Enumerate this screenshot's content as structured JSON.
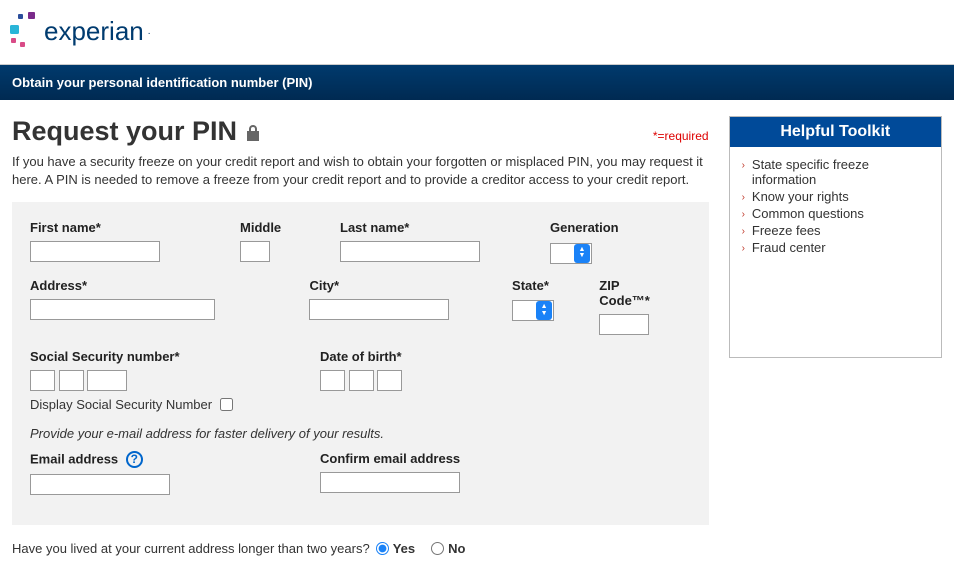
{
  "logo": {
    "text": "experian"
  },
  "banner": "Obtain your personal identification number (PIN)",
  "title": "Request your PIN",
  "required_legend": "*=required",
  "intro": "If you have a security freeze on your credit report and wish to obtain your forgotten or misplaced PIN, you may request it here. A PIN is needed to remove a freeze from your credit report and to provide a creditor access to your credit report.",
  "labels": {
    "first_name": "First name*",
    "middle": "Middle",
    "last_name": "Last name*",
    "generation": "Generation",
    "address": "Address*",
    "city": "City*",
    "state": "State*",
    "zip": "ZIP Code™*",
    "ssn": "Social Security number*",
    "dob": "Date of birth*",
    "display_ssn": "Display Social Security Number",
    "email_hint": "Provide your e-mail address for faster delivery of your results.",
    "email": "Email address",
    "confirm_email": "Confirm email address"
  },
  "values": {
    "first_name": "",
    "middle": "",
    "last_name": "",
    "generation": "",
    "address": "",
    "city": "",
    "state": "",
    "zip": "",
    "ssn1": "",
    "ssn2": "",
    "ssn3": "",
    "dob1": "",
    "dob2": "",
    "dob3": "",
    "display_ssn_checked": false,
    "email": "",
    "confirm_email": ""
  },
  "radio_q": {
    "question": "Have you lived at your current address longer than two years?",
    "yes": "Yes",
    "no": "No",
    "selected": "yes"
  },
  "toolkit": {
    "header": "Helpful Toolkit",
    "items": [
      "State specific freeze information",
      "Know your rights",
      "Common questions",
      "Freeze fees",
      "Fraud center"
    ]
  }
}
